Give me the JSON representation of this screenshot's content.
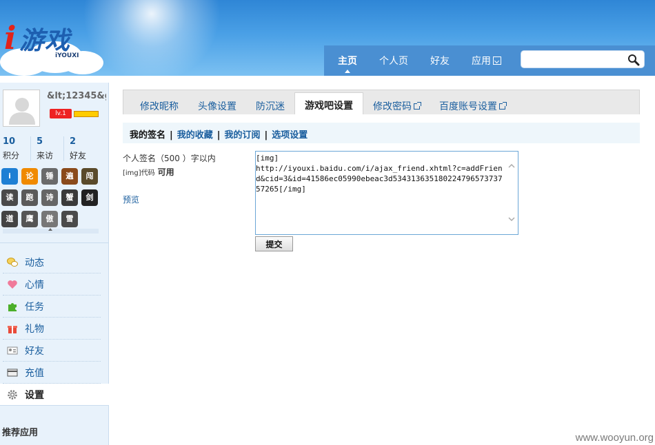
{
  "logo": {
    "i": "i",
    "main": "游戏",
    "sub": "iYOUXI"
  },
  "nav": {
    "items": [
      {
        "label": "主页"
      },
      {
        "label": "个人页"
      },
      {
        "label": "好友"
      },
      {
        "label": "应用"
      }
    ],
    "search_placeholder": ""
  },
  "profile": {
    "username": "&lt;12345&g",
    "level": "lv.1",
    "stats": [
      {
        "value": "10",
        "label": "积分"
      },
      {
        "value": "5",
        "label": "来访"
      },
      {
        "value": "2",
        "label": "好友"
      }
    ],
    "badges": [
      "i",
      "论",
      "锤",
      "遍",
      "闯",
      "读",
      "跑",
      "诗",
      "蟹",
      "剑",
      "道",
      "鹰",
      "傲",
      "雪"
    ]
  },
  "sidebar_menu": [
    {
      "label": "动态",
      "icon": "chat-bubble-icon"
    },
    {
      "label": "心情",
      "icon": "heart-icon"
    },
    {
      "label": "任务",
      "icon": "puzzle-icon"
    },
    {
      "label": "礼物",
      "icon": "gift-icon"
    },
    {
      "label": "好友",
      "icon": "id-card-icon"
    },
    {
      "label": "充值",
      "icon": "card-icon"
    },
    {
      "label": "设置",
      "icon": "gear-icon"
    }
  ],
  "recommend_label": "推荐应用",
  "tabs": [
    {
      "label": "修改昵称"
    },
    {
      "label": "头像设置"
    },
    {
      "label": "防沉迷"
    },
    {
      "label": "游戏吧设置"
    },
    {
      "label": "修改密码"
    },
    {
      "label": "百度账号设置"
    }
  ],
  "subnav": {
    "items": [
      "我的签名",
      "我的收藏",
      "我的订阅",
      "选项设置"
    ],
    "separator": "|"
  },
  "form": {
    "label_line1": "个人签名（500 ）字以内",
    "code_label": "[img]代码",
    "code_status": "可用",
    "preview_label": "预览",
    "signature_value": "[img]\nhttp://iyouxi.baidu.com/i/ajax_friend.xhtml?c=addFriend&cid=3&id=41586ec05990ebeac3d53431363518022479657373757265[/img]",
    "submit_label": "提交"
  },
  "watermark": "www.wooyun.org",
  "colors": {
    "link": "#1a5e9e",
    "header_blue": "#2f86d6",
    "sidebar_bg": "#e8f2fb",
    "level_badge": "#ee2222"
  }
}
